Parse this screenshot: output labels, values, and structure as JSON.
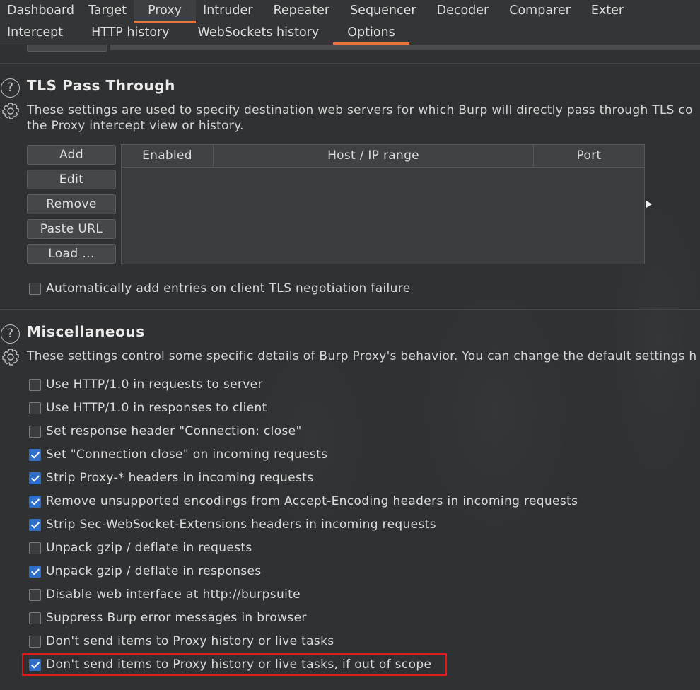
{
  "top_tabs": [
    "Dashboard",
    "Target",
    "Proxy",
    "Intruder",
    "Repeater",
    "Sequencer",
    "Decoder",
    "Comparer",
    "Exter"
  ],
  "active_top_tab": "Proxy",
  "sub_tabs": [
    "Intercept",
    "HTTP history",
    "WebSockets history",
    "Options"
  ],
  "active_sub_tab": "Options",
  "tls_pass_through": {
    "title": "TLS Pass Through",
    "description_line1": "These settings are used to specify destination web servers for which Burp will directly pass through TLS co",
    "description_line2": "the Proxy intercept view or history.",
    "buttons": [
      "Add",
      "Edit",
      "Remove",
      "Paste URL",
      "Load ..."
    ],
    "table_columns": [
      "Enabled",
      "Host / IP range",
      "Port"
    ],
    "auto_add_label": "Automatically add entries on client TLS negotiation failure",
    "auto_add_checked": false
  },
  "miscellaneous": {
    "title": "Miscellaneous",
    "description": "These settings control some specific details of Burp Proxy's behavior. You can change the default settings h",
    "options": [
      {
        "label": "Use HTTP/1.0 in requests to server",
        "checked": false
      },
      {
        "label": "Use HTTP/1.0 in responses to client",
        "checked": false
      },
      {
        "label": "Set response header \"Connection: close\"",
        "checked": false
      },
      {
        "label": "Set \"Connection close\" on incoming requests",
        "checked": true
      },
      {
        "label": "Strip Proxy-* headers in incoming requests",
        "checked": true
      },
      {
        "label": "Remove unsupported encodings from Accept-Encoding headers in incoming requests",
        "checked": true
      },
      {
        "label": "Strip Sec-WebSocket-Extensions headers in incoming requests",
        "checked": true
      },
      {
        "label": "Unpack gzip / deflate in requests",
        "checked": false
      },
      {
        "label": "Unpack gzip / deflate in responses",
        "checked": true
      },
      {
        "label": "Disable web interface at http://burpsuite",
        "checked": false
      },
      {
        "label": "Suppress Burp error messages in browser",
        "checked": false
      },
      {
        "label": "Don't send items to Proxy history or live tasks",
        "checked": false
      },
      {
        "label": "Don't send items to Proxy history or live tasks, if out of scope",
        "checked": true
      }
    ]
  },
  "icons": {
    "help": "question-circle-icon",
    "settings": "gear-icon"
  },
  "colors": {
    "accent": "#e8743b",
    "checkbox": "#2f6fc9",
    "highlight": "#e11a1a"
  }
}
